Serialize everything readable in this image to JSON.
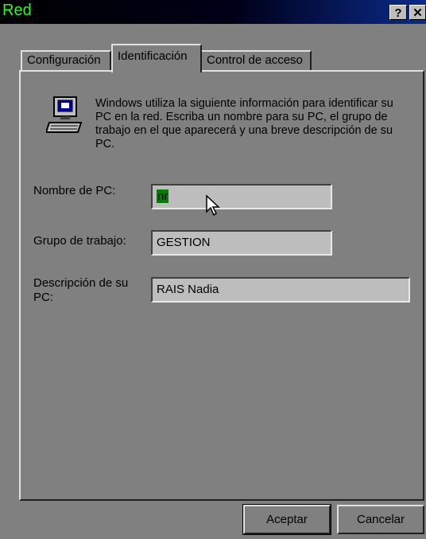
{
  "window": {
    "title": "Red",
    "help_label": "?",
    "close_label": "✕"
  },
  "tabs": [
    {
      "label": "Configuración"
    },
    {
      "label": "Identificación"
    },
    {
      "label": "Control de acceso"
    }
  ],
  "info_text": "Windows utiliza la siguiente información para identificar su PC en la red. Escriba un nombre para su PC, el grupo de trabajo en el que aparecerá y una breve descripción de su PC.",
  "fields": {
    "pc_name": {
      "label": "Nombre de PC:",
      "value": "nr"
    },
    "workgroup": {
      "label": "Grupo de trabajo:",
      "value": "GESTION"
    },
    "description": {
      "label": "Descripción de su PC:",
      "value": "RAIS Nadia"
    }
  },
  "buttons": {
    "ok": "Aceptar",
    "cancel": "Cancelar"
  },
  "colors": {
    "title_text": "#22ff22",
    "window_bg": "#808080",
    "selection": "#008000"
  },
  "icons": {
    "computer": "computer-icon",
    "cursor": "mouse-pointer-icon"
  }
}
